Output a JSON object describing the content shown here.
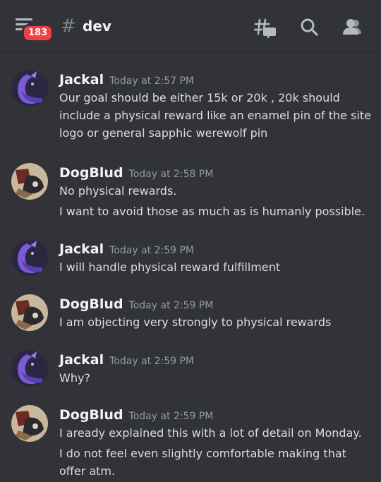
{
  "header": {
    "notification_count": "183",
    "hash_symbol": "#",
    "channel_name": "dev",
    "icons": [
      "menu-icon",
      "threads-icon",
      "search-icon",
      "members-icon"
    ]
  },
  "colors": {
    "background": "#313338",
    "badge": "#f23f43",
    "author": "#f2f3f5",
    "timestamp": "#949ba4",
    "text": "#dbdee1"
  },
  "messages": [
    {
      "author": "Jackal",
      "timestamp": "Today at 2:57 PM",
      "lines": [
        "Our goal should be either 15k or 20k , 20k should include a physical reward like an enamel pin of the site logo or general sapphic werewolf pin"
      ]
    },
    {
      "author": "DogBlud",
      "timestamp": "Today at 2:58 PM",
      "lines": [
        "No physical rewards.",
        "I want to avoid those as much as is humanly possible."
      ]
    },
    {
      "author": "Jackal",
      "timestamp": "Today at 2:59 PM",
      "lines": [
        "I will handle physical reward fulfillment"
      ]
    },
    {
      "author": "DogBlud",
      "timestamp": "Today at 2:59 PM",
      "lines": [
        "I am objecting very strongly to physical rewards"
      ]
    },
    {
      "author": "Jackal",
      "timestamp": "Today at 2:59 PM",
      "lines": [
        "Why?"
      ]
    },
    {
      "author": "DogBlud",
      "timestamp": "Today at 2:59 PM",
      "lines": [
        "I aready explained this with a lot of detail on Monday.",
        "I do not feel even slightly comfortable making that offer atm."
      ]
    }
  ]
}
